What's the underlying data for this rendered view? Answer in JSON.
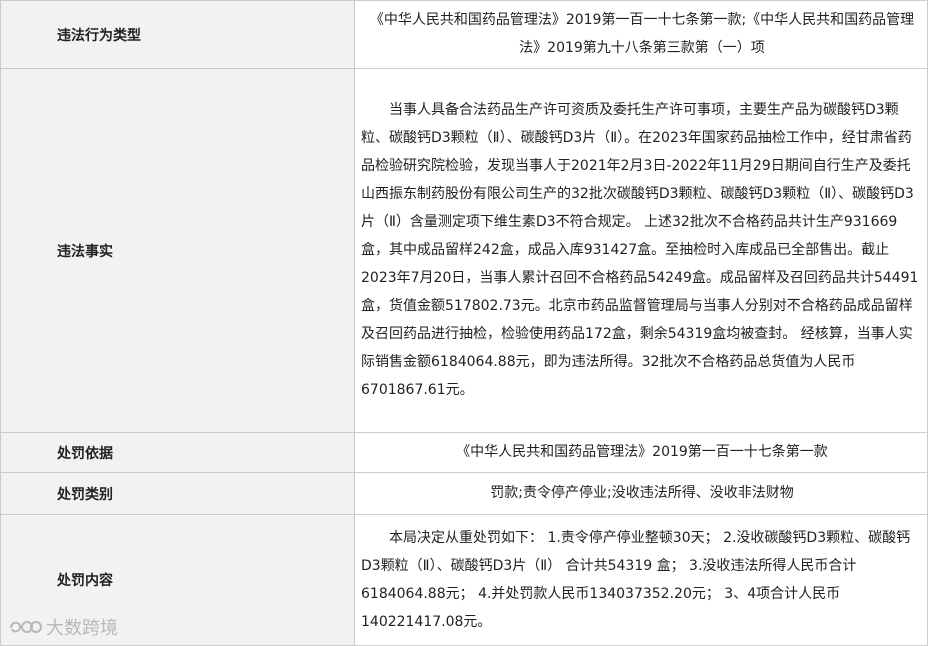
{
  "rows": [
    {
      "label": "违法行为类型",
      "value": "《中华人民共和国药品管理法》2019第一百一十七条第一款;《中华人民共和国药品管理法》2019第九十八条第三款第（一）项"
    },
    {
      "label": "违法事实",
      "value": "当事人具备合法药品生产许可资质及委托生产许可事项，主要生产品为碳酸钙D3颗粒、碳酸钙D3颗粒（Ⅱ）、碳酸钙D3片（Ⅱ）。在2023年国家药品抽检工作中，经甘肃省药品检验研究院检验，发现当事人于2021年2月3日-2022年11月29日期间自行生产及委托山西振东制药股份有限公司生产的32批次碳酸钙D3颗粒、碳酸钙D3颗粒（Ⅱ）、碳酸钙D3片（Ⅱ）含量测定项下维生素D3不符合规定。 上述32批次不合格药品共计生产931669盒，其中成品留样242盒，成品入库931427盒。至抽检时入库成品已全部售出。截止2023年7月20日，当事人累计召回不合格药品54249盒。成品留样及召回药品共计54491盒，货值金额517802.73元。北京市药品监督管理局与当事人分别对不合格药品成品留样及召回药品进行抽检，检验使用药品172盒，剩余54319盒均被查封。 经核算，当事人实际销售金额6184064.88元，即为违法所得。32批次不合格药品总货值为人民币6701867.61元。"
    },
    {
      "label": "处罚依据",
      "value": "《中华人民共和国药品管理法》2019第一百一十七条第一款"
    },
    {
      "label": "处罚类别",
      "value": "罚款;责令停产停业;没收违法所得、没收非法财物"
    },
    {
      "label": "处罚内容",
      "value": "本局决定从重处罚如下： 1.责令停产停业整顿30天； 2.没收碳酸钙D3颗粒、碳酸钙D3颗粒（Ⅱ）、碳酸钙D3片（Ⅱ） 合计共54319 盒； 3.没收违法所得人民币合计6184064.88元； 4.并处罚款人民币134037352.20元； 3、4项合计人民币140221417.08元。"
    }
  ],
  "watermark": {
    "text": "大数跨境"
  }
}
